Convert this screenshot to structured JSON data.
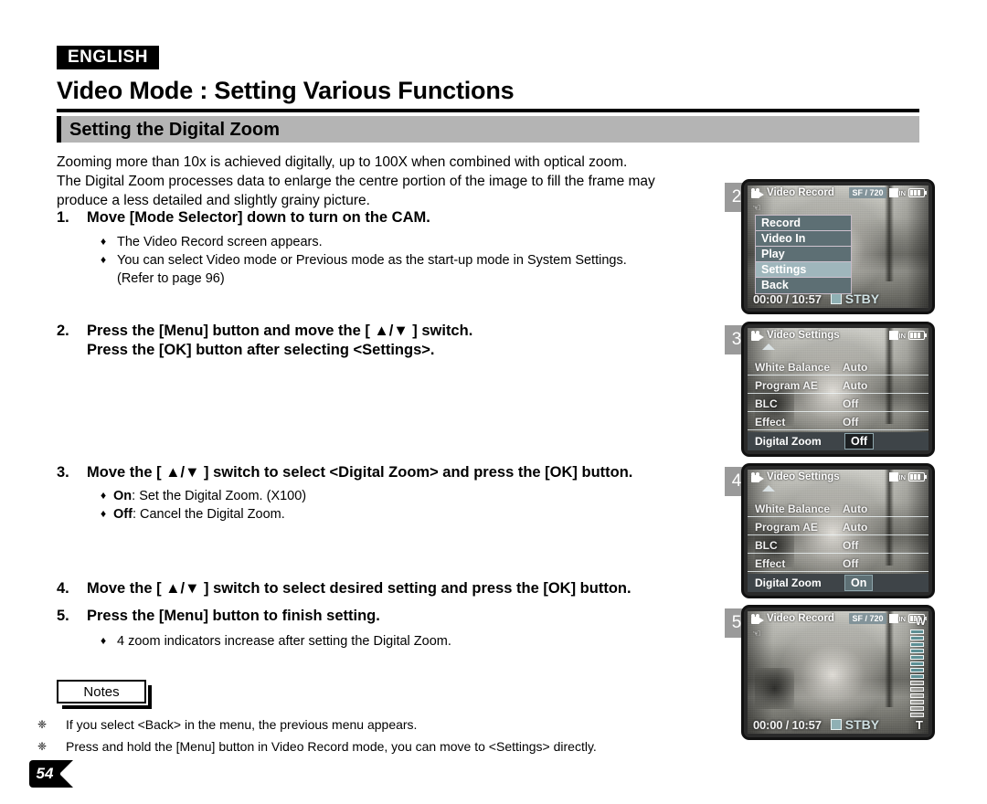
{
  "header": {
    "language_badge": "ENGLISH",
    "page_title": "Video Mode : Setting Various Functions",
    "section_title": "Setting the Digital Zoom"
  },
  "intro": [
    "Zooming more than 10x is achieved digitally, up to 100X when combined with optical zoom.",
    "The Digital Zoom processes data to enlarge the centre portion of the image to fill the frame may",
    "produce a less detailed and slightly grainy picture."
  ],
  "steps": [
    {
      "num": "1.",
      "line1": "Move [Mode Selector] down to turn on the CAM.",
      "line2": "",
      "bullets": [
        {
          "bold": "",
          "text": "The Video Record screen appears."
        },
        {
          "bold": "",
          "text": "You can select Video mode or Previous mode as the start-up mode in System Settings."
        },
        {
          "bold": "",
          "text": "(Refer to page 96)",
          "nodot": true
        }
      ]
    },
    {
      "num": "2.",
      "line1": "Press the [Menu] button and move the [ ▲/▼ ] switch.",
      "line2": "Press the [OK] button after selecting <Settings>.",
      "bullets": []
    },
    {
      "num": "3.",
      "line1": "Move the [ ▲/▼ ] switch to select <Digital Zoom> and press the [OK] button.",
      "line2": "",
      "bullets": [
        {
          "bold": "On",
          "text": ": Set the Digital Zoom. (X100)"
        },
        {
          "bold": "Off",
          "text": ": Cancel the Digital Zoom."
        }
      ]
    },
    {
      "num": "4.",
      "line1": "Move the [ ▲/▼ ] switch to select desired setting and press the [OK] button.",
      "line2": "",
      "bullets": []
    },
    {
      "num": "5.",
      "line1": "Press the [Menu] button to finish setting.",
      "line2": "",
      "bullets": [
        {
          "bold": "",
          "text": "4 zoom indicators increase after setting the Digital Zoom."
        }
      ]
    }
  ],
  "notes": {
    "tab_label": "Notes",
    "items": [
      "If you select <Back> in the menu, the previous menu appears.",
      "Press and hold the [Menu] button in Video Record mode, you can move to <Settings> directly."
    ]
  },
  "page_number": "54",
  "panels": [
    {
      "badge": "2",
      "type": "record-menu",
      "status": {
        "title": "Video Record",
        "quality": "SF  /  720",
        "in_label": "IN"
      },
      "menu": [
        {
          "label": "Record",
          "selected": false
        },
        {
          "label": "Video In",
          "selected": false
        },
        {
          "label": "Play",
          "selected": false
        },
        {
          "label": "Settings",
          "selected": true
        },
        {
          "label": "Back",
          "selected": false
        }
      ],
      "bottom": {
        "timecode": "00:00 / 10:57",
        "status": "STBY"
      }
    },
    {
      "badge": "3",
      "type": "settings",
      "status": {
        "title": "Video Settings"
      },
      "rows": [
        {
          "label": "White Balance",
          "value": "Auto",
          "active": false
        },
        {
          "label": "Program AE",
          "value": "Auto",
          "active": false
        },
        {
          "label": "BLC",
          "value": "Off",
          "active": false
        },
        {
          "label": "Effect",
          "value": "Off",
          "active": false
        },
        {
          "label": "Digital Zoom",
          "value": "Off",
          "active": true
        }
      ]
    },
    {
      "badge": "4",
      "type": "settings",
      "status": {
        "title": "Video Settings"
      },
      "rows": [
        {
          "label": "White Balance",
          "value": "Auto",
          "active": false
        },
        {
          "label": "Program AE",
          "value": "Auto",
          "active": false
        },
        {
          "label": "BLC",
          "value": "Off",
          "active": false
        },
        {
          "label": "Effect",
          "value": "Off",
          "active": false
        },
        {
          "label": "Digital Zoom",
          "value": "On",
          "active": true
        }
      ]
    },
    {
      "badge": "5",
      "type": "record-zoom",
      "status": {
        "title": "Video Record",
        "quality": "SF  /  720",
        "in_label": "IN"
      },
      "zoom": {
        "wide_label": "W",
        "tele_label": "T",
        "segments_total": 14,
        "segments_on": 8
      },
      "bottom": {
        "timecode": "00:00 / 10:57",
        "status": "STBY"
      }
    }
  ]
}
